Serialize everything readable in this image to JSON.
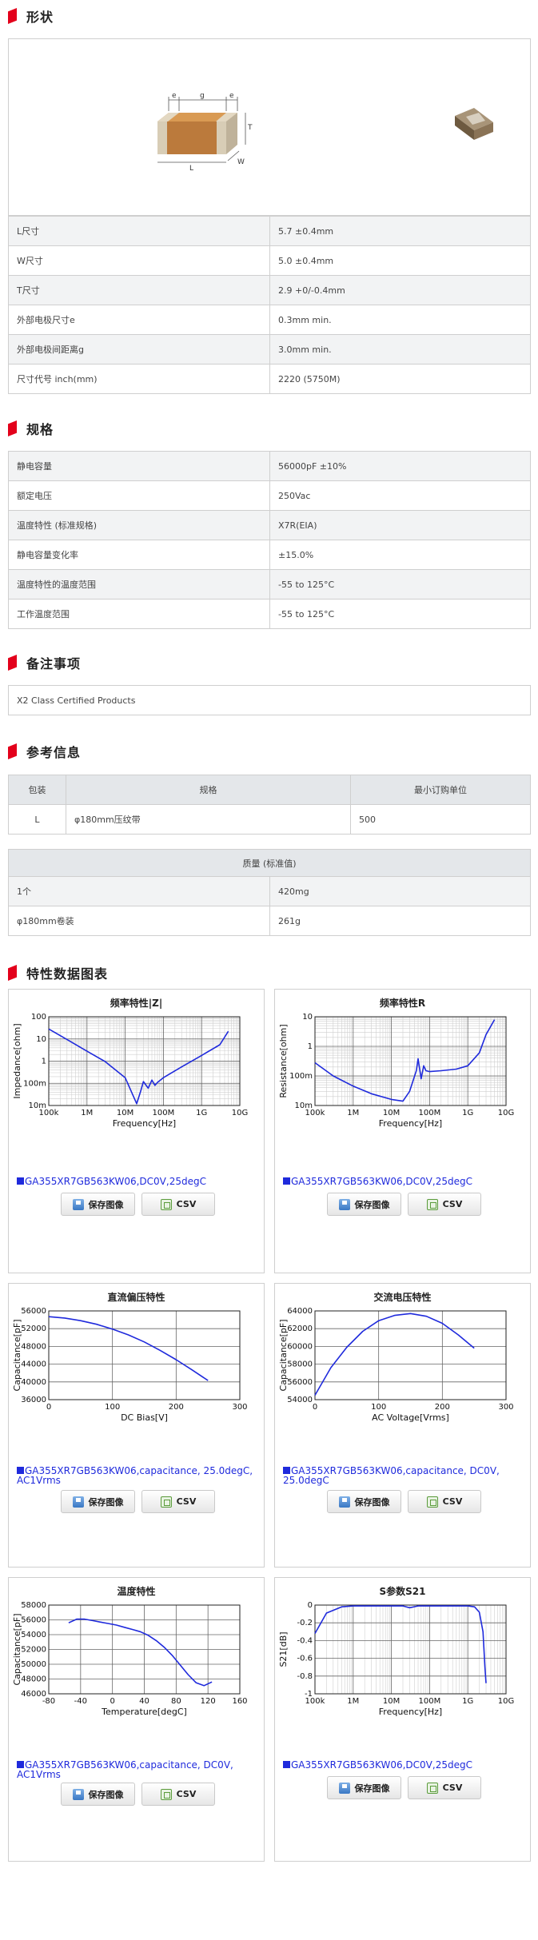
{
  "sections": {
    "shape": "形状",
    "spec": "规格",
    "notes": "备注事项",
    "ref": "参考信息",
    "charts": "特性数据图表"
  },
  "shape_labels": {
    "e1": "e",
    "g": "g",
    "e2": "e",
    "T": "T",
    "L": "L",
    "W": "W"
  },
  "dims": [
    {
      "label": "L尺寸",
      "value": "5.7 ±0.4mm"
    },
    {
      "label": "W尺寸",
      "value": "5.0 ±0.4mm"
    },
    {
      "label": "T尺寸",
      "value": "2.9 +0/-0.4mm"
    },
    {
      "label": "外部电极尺寸e",
      "value": "0.3mm min."
    },
    {
      "label": "外部电极间距离g",
      "value": "3.0mm min."
    },
    {
      "label": "尺寸代号 inch(mm)",
      "value": "2220 (5750M)"
    }
  ],
  "specs": [
    {
      "label": "静电容量",
      "value": "56000pF ±10%"
    },
    {
      "label": "额定电压",
      "value": "250Vac"
    },
    {
      "label": "温度特性 (标准规格)",
      "value": "X7R(EIA)"
    },
    {
      "label": "静电容量变化率",
      "value": "±15.0%"
    },
    {
      "label": "温度特性的温度范围",
      "value": "-55 to 125°C"
    },
    {
      "label": "工作温度范围",
      "value": "-55 to 125°C"
    }
  ],
  "notes_text": "X2 Class Certified Products",
  "pack": {
    "headers": [
      "包装",
      "规格",
      "最小订购单位"
    ],
    "row": [
      "L",
      "φ180mm压纹带",
      "500"
    ]
  },
  "mass": {
    "header": "质量 (标准值)",
    "rows": [
      {
        "label": "1个",
        "value": "420mg"
      },
      {
        "label": "φ180mm卷装",
        "value": "261g"
      }
    ]
  },
  "buttons": {
    "save": "保存图像",
    "csv": "CSV"
  },
  "icons": {
    "save": "save-image-icon",
    "csv": "csv-file-icon"
  },
  "colors": {
    "accent": "#e3001b",
    "curve": "#1f2adc"
  },
  "charts": [
    {
      "title": "频率特性|Z|",
      "caption": "GA355XR7GB563KW06,DC0V,25degC",
      "chart_data": {
        "type": "line",
        "xlabel": "Frequency[Hz]",
        "ylabel": "Impedance[ohm]",
        "xscale": "log",
        "yscale": "log",
        "xlim": [
          100000,
          10000000000
        ],
        "ylim": [
          0.01,
          100
        ],
        "xticks": [
          "100k",
          "1M",
          "10M",
          "100M",
          "1G",
          "10G"
        ],
        "yticks": [
          "100",
          "10",
          "1",
          "100m",
          "10m"
        ],
        "x": [
          100000,
          300000,
          1000000,
          3000000,
          10000000,
          20000000,
          25000000,
          30000000,
          40000000,
          50000000,
          60000000,
          70000000,
          100000000,
          300000000,
          1000000000,
          3000000000,
          5000000000
        ],
        "y": [
          28,
          9.5,
          2.8,
          0.95,
          0.18,
          0.012,
          0.04,
          0.12,
          0.06,
          0.14,
          0.08,
          0.11,
          0.18,
          0.55,
          1.8,
          5.5,
          22
        ]
      }
    },
    {
      "title": "频率特性R",
      "caption": "GA355XR7GB563KW06,DC0V,25degC",
      "chart_data": {
        "type": "line",
        "xlabel": "Frequency[Hz]",
        "ylabel": "Resistance[ohm]",
        "xscale": "log",
        "yscale": "log",
        "xlim": [
          100000,
          10000000000
        ],
        "ylim": [
          0.01,
          10
        ],
        "xticks": [
          "100k",
          "1M",
          "10M",
          "100M",
          "1G",
          "10G"
        ],
        "yticks": [
          "10",
          "1",
          "100m",
          "10m"
        ],
        "x": [
          100000,
          300000,
          1000000,
          3000000,
          10000000,
          20000000,
          30000000,
          45000000,
          50000000,
          60000000,
          70000000,
          80000000,
          100000000,
          200000000,
          500000000,
          1000000000,
          2000000000,
          3000000000,
          5000000000
        ],
        "y": [
          0.28,
          0.1,
          0.045,
          0.025,
          0.016,
          0.014,
          0.03,
          0.15,
          0.38,
          0.08,
          0.22,
          0.15,
          0.14,
          0.15,
          0.17,
          0.22,
          0.6,
          2.5,
          8
        ]
      }
    },
    {
      "title": "直流偏压特性",
      "caption": "GA355XR7GB563KW06,capacitance, 25.0degC, AC1Vrms",
      "chart_data": {
        "type": "line",
        "xlabel": "DC Bias[V]",
        "ylabel": "Capacitance[pF]",
        "xlim": [
          0,
          300
        ],
        "ylim": [
          36000,
          56000
        ],
        "xticks": [
          "0",
          "100",
          "200",
          "300"
        ],
        "yticks": [
          "56000",
          "52000",
          "48000",
          "44000",
          "40000",
          "36000"
        ],
        "x": [
          0,
          25,
          50,
          75,
          100,
          125,
          150,
          175,
          200,
          225,
          250
        ],
        "y": [
          54700,
          54400,
          53800,
          53000,
          51900,
          50600,
          49000,
          47100,
          45000,
          42700,
          40300
        ]
      }
    },
    {
      "title": "交流电压特性",
      "caption": "GA355XR7GB563KW06,capacitance, DC0V, 25.0degC",
      "chart_data": {
        "type": "line",
        "xlabel": "AC Voltage[Vrms]",
        "ylabel": "Capacitance[pF]",
        "xlim": [
          0,
          300
        ],
        "ylim": [
          54000,
          64000
        ],
        "xticks": [
          "0",
          "100",
          "200",
          "300"
        ],
        "yticks": [
          "64000",
          "62000",
          "60000",
          "58000",
          "56000",
          "54000"
        ],
        "x": [
          0,
          25,
          50,
          75,
          100,
          125,
          150,
          175,
          200,
          225,
          250
        ],
        "y": [
          54500,
          57600,
          59900,
          61700,
          62900,
          63500,
          63700,
          63400,
          62600,
          61300,
          59800
        ]
      }
    },
    {
      "title": "温度特性",
      "caption": "GA355XR7GB563KW06,capacitance, DC0V, AC1Vrms",
      "chart_data": {
        "type": "line",
        "xlabel": "Temperature[degC]",
        "ylabel": "Capacitance[pF]",
        "xlim": [
          -80,
          160
        ],
        "ylim": [
          46000,
          58000
        ],
        "xticks": [
          "-80",
          "-40",
          "0",
          "40",
          "80",
          "120",
          "160"
        ],
        "yticks": [
          "58000",
          "56000",
          "54000",
          "52000",
          "50000",
          "48000",
          "46000"
        ],
        "x": [
          -55,
          -45,
          -35,
          -25,
          -15,
          -5,
          5,
          15,
          25,
          35,
          45,
          55,
          65,
          75,
          85,
          95,
          105,
          115,
          125
        ],
        "y": [
          55600,
          56100,
          56100,
          55900,
          55700,
          55500,
          55300,
          55000,
          54700,
          54400,
          53900,
          53200,
          52300,
          51200,
          49900,
          48600,
          47500,
          47100,
          47600
        ]
      }
    },
    {
      "title": "S参数S21",
      "caption": "GA355XR7GB563KW06,DC0V,25degC",
      "chart_data": {
        "type": "line",
        "xlabel": "Frequency[Hz]",
        "ylabel": "S21[dB]",
        "xscale": "log",
        "xlim": [
          100000,
          10000000000
        ],
        "ylim": [
          -1,
          0
        ],
        "xticks": [
          "100k",
          "1M",
          "10M",
          "100M",
          "1G",
          "10G"
        ],
        "yticks": [
          "0",
          "-0.2",
          "-0.4",
          "-0.6",
          "-0.8",
          "-1"
        ],
        "x": [
          100000,
          200000,
          500000,
          1000000,
          10000000,
          20000000,
          30000000,
          50000000,
          100000000,
          500000000,
          1000000000,
          1500000000,
          2000000000,
          2500000000,
          2800000000,
          3000000000
        ],
        "y": [
          -0.32,
          -0.09,
          -0.02,
          -0.01,
          -0.01,
          -0.01,
          -0.03,
          -0.01,
          -0.01,
          -0.01,
          -0.01,
          -0.02,
          -0.08,
          -0.3,
          -0.7,
          -0.88
        ]
      }
    }
  ]
}
